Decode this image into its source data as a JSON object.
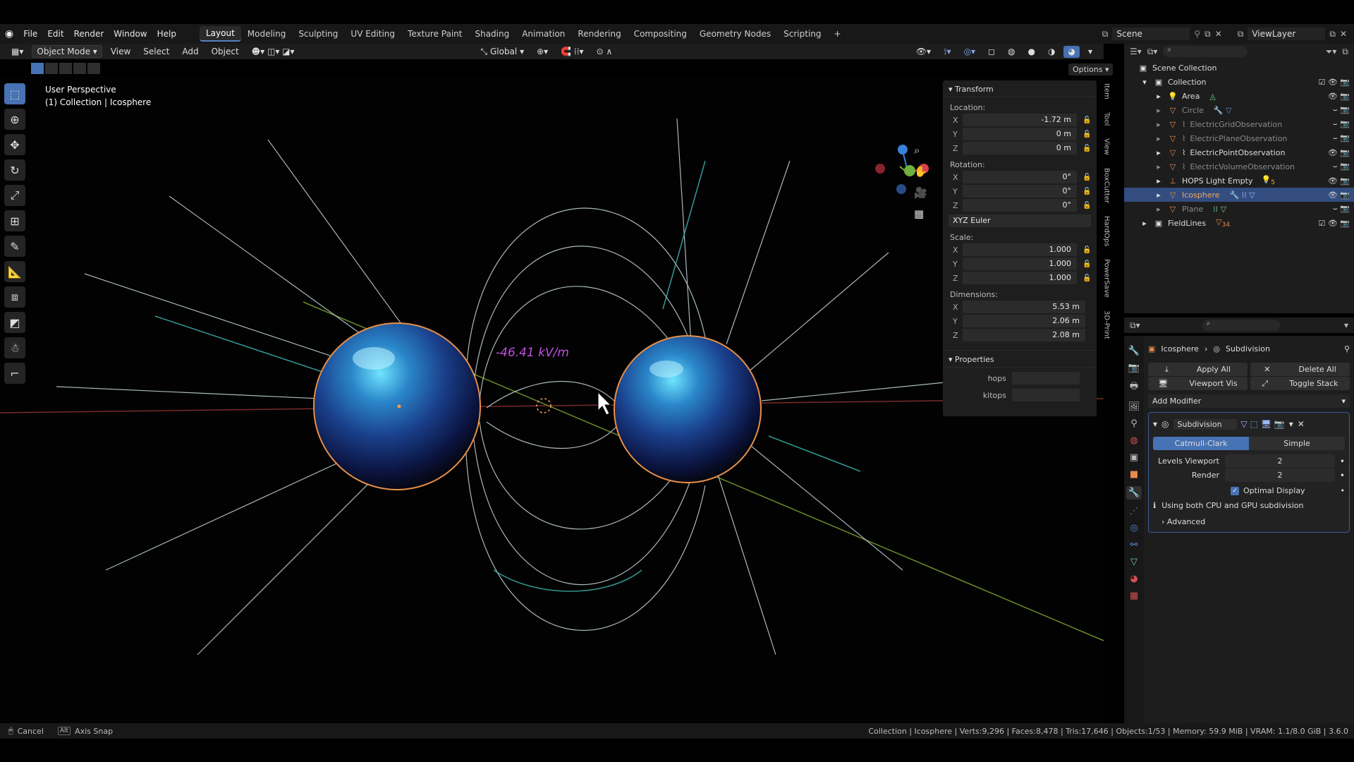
{
  "menu": {
    "items": [
      "File",
      "Edit",
      "Render",
      "Window",
      "Help"
    ],
    "workspaces": [
      "Layout",
      "Modeling",
      "Sculpting",
      "UV Editing",
      "Texture Paint",
      "Shading",
      "Animation",
      "Rendering",
      "Compositing",
      "Geometry Nodes",
      "Scripting"
    ],
    "add_tab": "+",
    "scene": "Scene",
    "view_layer": "ViewLayer"
  },
  "header": {
    "mode": "Object Mode",
    "view": "View",
    "select": "Select",
    "add": "Add",
    "object": "Object",
    "transform": "Global",
    "options": "Options"
  },
  "viewport": {
    "perspective": "User Perspective",
    "context": "(1) Collection | Icosphere",
    "measure": "-46.41 kV/m"
  },
  "npanel": {
    "transform_title": "Transform",
    "location_label": "Location:",
    "loc": [
      "-1.72 m",
      "0 m",
      "0 m"
    ],
    "rotation_label": "Rotation:",
    "rot": [
      "0°",
      "0°",
      "0°"
    ],
    "rotation_mode": "XYZ Euler",
    "scale_label": "Scale:",
    "scale": [
      "1.000",
      "1.000",
      "1.000"
    ],
    "dimensions_label": "Dimensions:",
    "dim": [
      "5.53 m",
      "2.06 m",
      "2.08 m"
    ],
    "properties_title": "Properties",
    "prop1": "hops",
    "prop2": "kitops",
    "axes": [
      "X",
      "Y",
      "Z"
    ]
  },
  "vtabs": [
    "Item",
    "Tool",
    "View",
    "BoxCutter",
    "HardOps",
    "PowerSave",
    "3D-Print"
  ],
  "outliner": {
    "title": "Scene Collection",
    "rows": [
      {
        "name": "Collection",
        "type": "collection"
      },
      {
        "name": "Area",
        "type": "light"
      },
      {
        "name": "Circle",
        "type": "mesh",
        "dim": true
      },
      {
        "name": "ElectricGridObservation",
        "type": "mesh",
        "dim": true
      },
      {
        "name": "ElectricPlaneObservation",
        "type": "mesh",
        "dim": true
      },
      {
        "name": "ElectricPointObservation",
        "type": "mesh"
      },
      {
        "name": "ElectricVolumeObservation",
        "type": "mesh",
        "dim": true
      },
      {
        "name": "HOPS Light Empty",
        "type": "empty"
      },
      {
        "name": "Icosphere",
        "type": "mesh",
        "selected": true
      },
      {
        "name": "Plane",
        "type": "mesh",
        "dim": true
      },
      {
        "name": "FieldLines",
        "type": "collection"
      }
    ],
    "badges": {
      "hops": "5",
      "fieldlines": "34"
    }
  },
  "properties": {
    "object": "Icosphere",
    "modifier_crumb": "Subdivision",
    "apply_all": "Apply All",
    "delete_all": "Delete All",
    "viewport_vis": "Viewport Vis",
    "toggle_stack": "Toggle Stack",
    "add_modifier": "Add Modifier",
    "modifier_name": "Subdivision",
    "catmull": "Catmull-Clark",
    "simple": "Simple",
    "levels_viewport_label": "Levels Viewport",
    "levels_viewport": "2",
    "render_label": "Render",
    "render": "2",
    "optimal": "Optimal Display",
    "info": "Using both CPU and GPU subdivision",
    "advanced": "Advanced"
  },
  "status": {
    "cancel": "Cancel",
    "alt": "Alt",
    "axis_snap": "Axis Snap",
    "stats": "Collection | Icosphere | Verts:9,296 | Faces:8,478 | Tris:17,646 | Objects:1/53 | Memory: 59.9 MiB | VRAM: 1.1/8.0 GiB | 3.6.0"
  }
}
